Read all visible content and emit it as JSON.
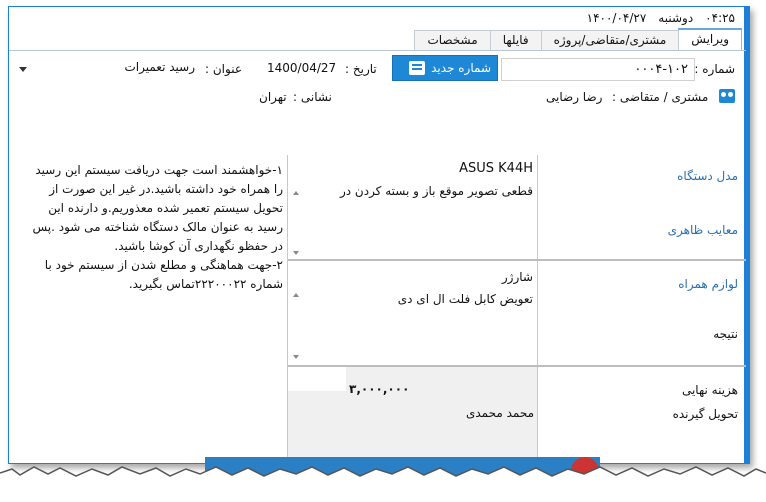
{
  "status": {
    "time": "۰۴:۲۵",
    "weekday": "دوشنبه",
    "date": "۱۴۰۰/۰۴/۲۷"
  },
  "tabs": [
    {
      "label": "ویرایش",
      "active": true
    },
    {
      "label": "مشتری/متقاضی/پروژه",
      "active": false
    },
    {
      "label": "فایلها",
      "active": false
    },
    {
      "label": "مشخصات",
      "active": false
    }
  ],
  "header": {
    "number_label": "شماره :",
    "number_value": "۰۰۰۴-۱۰۲",
    "new_number_button": "شماره جدید",
    "date_label": "تاریخ :",
    "date_value": "1400/04/27",
    "subject_label": "عنوان :",
    "subject_value": "رسید تعمیرات",
    "customer_label": "مشتری / متقاضی :",
    "customer_value": "رضا رضایی",
    "address_label": "نشانی :",
    "address_value": "تهران"
  },
  "form": {
    "device_model_label": "مدل دستگاه",
    "device_model_value": "ASUS K44H",
    "defects_label": "معایب ظاهری",
    "defects_value": "قطعی تصویر موقع باز و بسته کردن در",
    "accessories_label": "لوازم همراه",
    "accessories_value_1": "شارژر",
    "accessories_value_2": "تعویض کابل فلت ال ای دی",
    "result_label": "نتیجه",
    "final_cost_label": "هزینه نهایی",
    "final_cost_value": "۳,۰۰۰,۰۰۰",
    "receiver_label": "تحویل گیرنده",
    "receiver_value": "محمد محمدی"
  },
  "notes": {
    "line1": "۱-خواهشمند است جهت دریافت سیستم این رسید",
    "line2": "را همراه خود داشته باشید.در غیر این صورت از",
    "line3": "تحویل سیستم تعمیر شده معذوریم.و دارنده این",
    "line4": "رسید به عنوان مالک دستگاه شناخته می شود .پس",
    "line5": "در حفظو نگهداری آن کوشا باشید.",
    "line6": "۲-جهت هماهنگی و مطلع شدن از سیستم خود با",
    "line7": "شماره ۲۲۲۰۰۰۲۲تماس بگیرید."
  },
  "colors": {
    "accent": "#1e88d6",
    "label_blue": "#2a6fb1"
  }
}
